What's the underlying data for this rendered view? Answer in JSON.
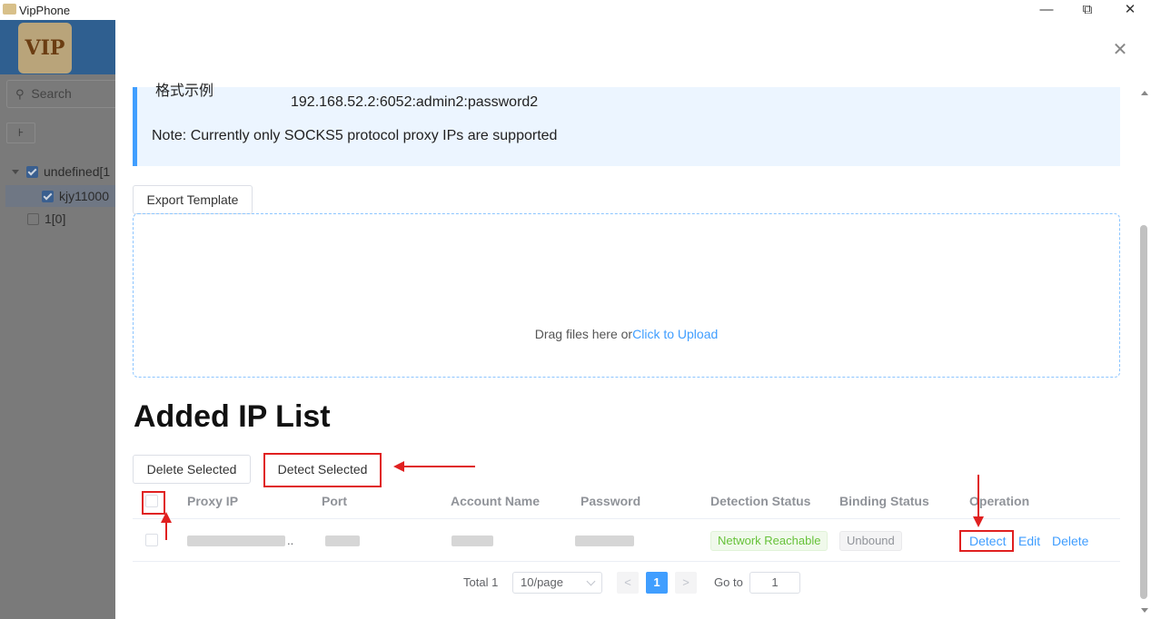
{
  "window": {
    "title": "VipPhone",
    "icons": {
      "app": "vip-app-icon",
      "minimize": "minimize-icon",
      "restore": "restore-icon",
      "close": "close-icon"
    },
    "controls": {
      "minimize": "—",
      "restore": "⧉",
      "close": "✕"
    }
  },
  "sidebar": {
    "logo_text": "VIP",
    "search_placeholder": "Search",
    "small_button": "⊦",
    "tree": [
      {
        "label": "undefined[1",
        "checked": true,
        "expanded": true
      },
      {
        "label": "kjy11000",
        "checked": true,
        "selected": true
      },
      {
        "label": "1[0]",
        "checked": false
      }
    ]
  },
  "drawer": {
    "close_icon": "✕",
    "info": {
      "partial_top": "格式示例",
      "format_example": "192.168.52.2:6052:admin2:password2",
      "note": "Note: Currently only SOCKS5 protocol proxy IPs are supported"
    },
    "export_template": "Export Template",
    "upload": {
      "text": "Drag files here or",
      "link": "Click to Upload"
    },
    "section_title": "Added IP List",
    "delete_selected": "Delete Selected",
    "detect_selected": "Detect Selected",
    "table": {
      "columns": [
        "Proxy IP",
        "Port",
        "Account Name",
        "Password",
        "Detection Status",
        "Binding Status",
        "Operation"
      ],
      "rows": [
        {
          "proxy_ip_suffix": "..",
          "detection_status": "Network Reachable",
          "binding_status": "Unbound",
          "actions": {
            "detect": "Detect",
            "edit": "Edit",
            "delete": "Delete"
          }
        }
      ]
    },
    "pagination": {
      "total": "Total 1",
      "page_size": "10/page",
      "prev": "<",
      "current_page": "1",
      "next": ">",
      "goto_label": "Go to",
      "goto_value": "1"
    }
  },
  "colors": {
    "accent": "#409eff",
    "annotation": "#e02020",
    "success": "#67c23a"
  }
}
